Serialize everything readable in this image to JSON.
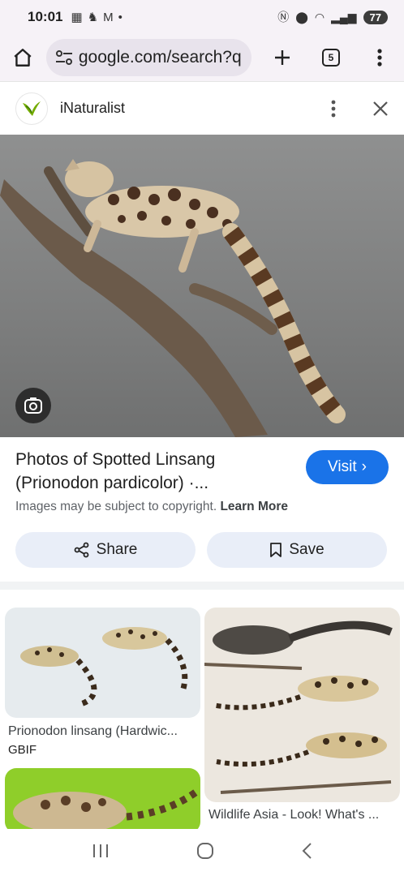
{
  "status_bar": {
    "time": "10:01",
    "battery": "77"
  },
  "url_bar": {
    "url": "google.com/search?q",
    "tab_count": "5"
  },
  "source": {
    "name": "iNaturalist"
  },
  "result": {
    "title": "Photos of Spotted Linsang (Prionodon pardicolor) ·...",
    "visit_label": "Visit",
    "copyright_text": "Images may be subject to copyright.",
    "learn_more": "Learn More",
    "share_label": "Share",
    "save_label": "Save"
  },
  "related": [
    {
      "caption": "Prionodon linsang (Hardwic...",
      "source": "GBIF"
    },
    {
      "caption": "Wildlife Asia - Look! What's ...",
      "source": ""
    }
  ],
  "colors": {
    "accent": "#1a73e8",
    "chrome": "#f6f2f7",
    "button_bg": "#e9eef8"
  },
  "icons": [
    "home-icon",
    "tune-icon",
    "plus-icon",
    "tabs-icon",
    "more-vert-icon",
    "close-icon",
    "lens-icon",
    "share-icon",
    "bookmark-icon",
    "recents-icon",
    "home-nav-icon",
    "back-icon"
  ]
}
